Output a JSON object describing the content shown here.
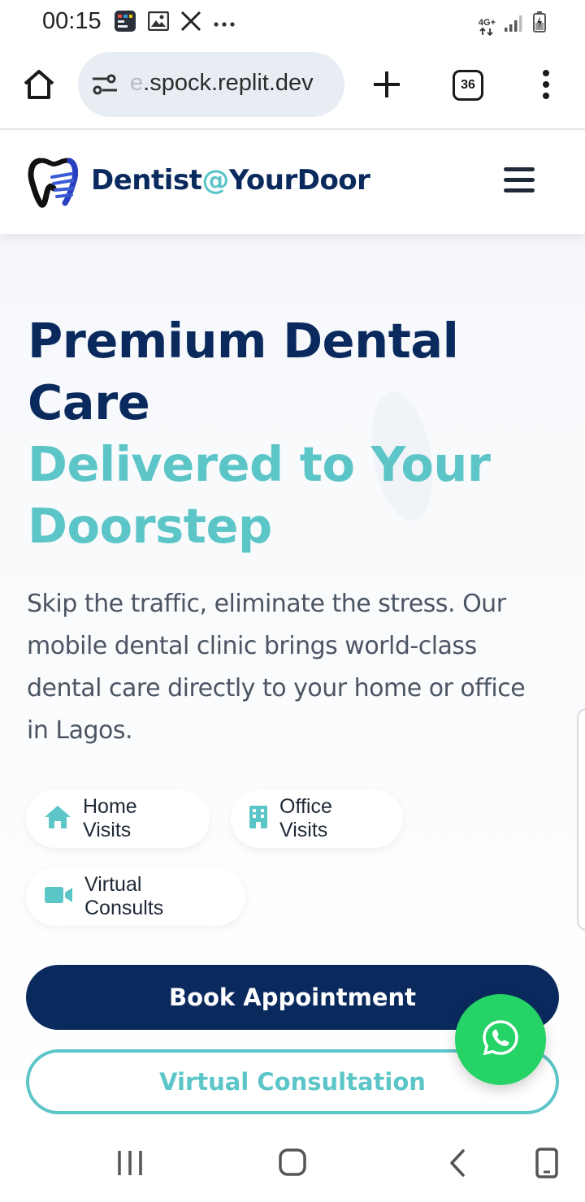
{
  "status_bar": {
    "time": "00:15",
    "icons": [
      "app-notification-icon",
      "image-icon",
      "x-logo-icon",
      "more-dots-icon"
    ],
    "network": "4G+",
    "right_icons": [
      "signal-icon",
      "battery-charging-icon"
    ]
  },
  "browser": {
    "url_faded": "e",
    "url_main": ".spock.replit.dev",
    "tab_count": "36",
    "icons": [
      "home-icon",
      "site-settings-icon",
      "new-tab-plus-icon",
      "tab-switcher-icon",
      "more-vert-icon"
    ]
  },
  "site_header": {
    "brand_main": "Dentist",
    "brand_at": "@",
    "brand_tail": "YourDoor",
    "logo": "tooth-logo-icon",
    "menu": "hamburger-icon"
  },
  "hero": {
    "title_line1": "Premium Dental",
    "title_line2": "Care",
    "title_line3": "Delivered to Your",
    "title_line4": "Doorstep",
    "description": "Skip the traffic, eliminate the stress. Our mobile dental clinic brings world-class dental care directly to your home or office in Lagos.",
    "chips": {
      "home": "Home Visits",
      "office": "Office Visits",
      "virtual": "Virtual Consults"
    },
    "book_button": "Book Appointment",
    "virtual_button": "Virtual Consultation"
  },
  "floating": {
    "whatsapp": "whatsapp-icon"
  },
  "colors": {
    "navy": "#0a2a5e",
    "teal": "#5cc5c7",
    "whatsapp_green": "#25d366",
    "text_gray": "#4b5563"
  },
  "nav_bar": {
    "icons": [
      "recent-apps-icon",
      "home-circle-icon",
      "back-icon",
      "screen-rotate-icon"
    ]
  }
}
